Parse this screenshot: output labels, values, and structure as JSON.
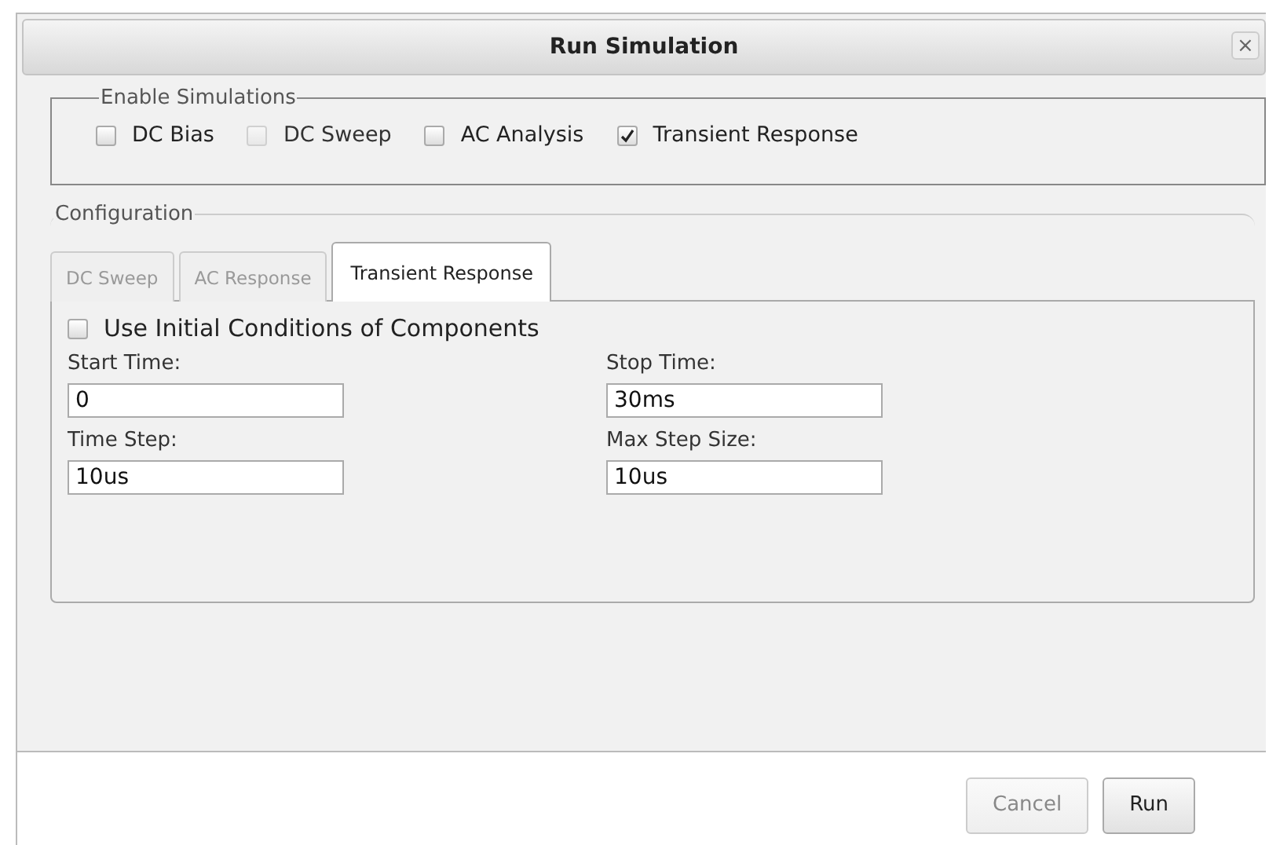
{
  "window": {
    "title": "Run Simulation",
    "close": "×"
  },
  "enable_simulations": {
    "legend": "Enable Simulations",
    "options": [
      {
        "label": "DC Bias",
        "checked": false,
        "disabled": false
      },
      {
        "label": "DC Sweep",
        "checked": false,
        "disabled": true
      },
      {
        "label": "AC Analysis",
        "checked": false,
        "disabled": false
      },
      {
        "label": "Transient Response",
        "checked": true,
        "disabled": false
      }
    ]
  },
  "configuration": {
    "legend": "Configuration",
    "tabs": [
      {
        "label": "DC Sweep",
        "selected": false,
        "disabled": true
      },
      {
        "label": "AC Response",
        "selected": false,
        "disabled": true
      },
      {
        "label": "Transient Response",
        "selected": true,
        "disabled": false
      }
    ],
    "use_initial_conditions": {
      "label": "Use Initial Conditions of Components",
      "checked": false
    },
    "fields": [
      {
        "label": "Start Time:",
        "value": "0"
      },
      {
        "label": "Stop Time:",
        "value": "30ms"
      },
      {
        "label": "Time Step:",
        "value": "10us"
      },
      {
        "label": "Max Step Size:",
        "value": "10us"
      }
    ]
  },
  "buttons": [
    {
      "label": "Cancel",
      "disabled": true
    },
    {
      "label": "Run",
      "disabled": false
    }
  ]
}
